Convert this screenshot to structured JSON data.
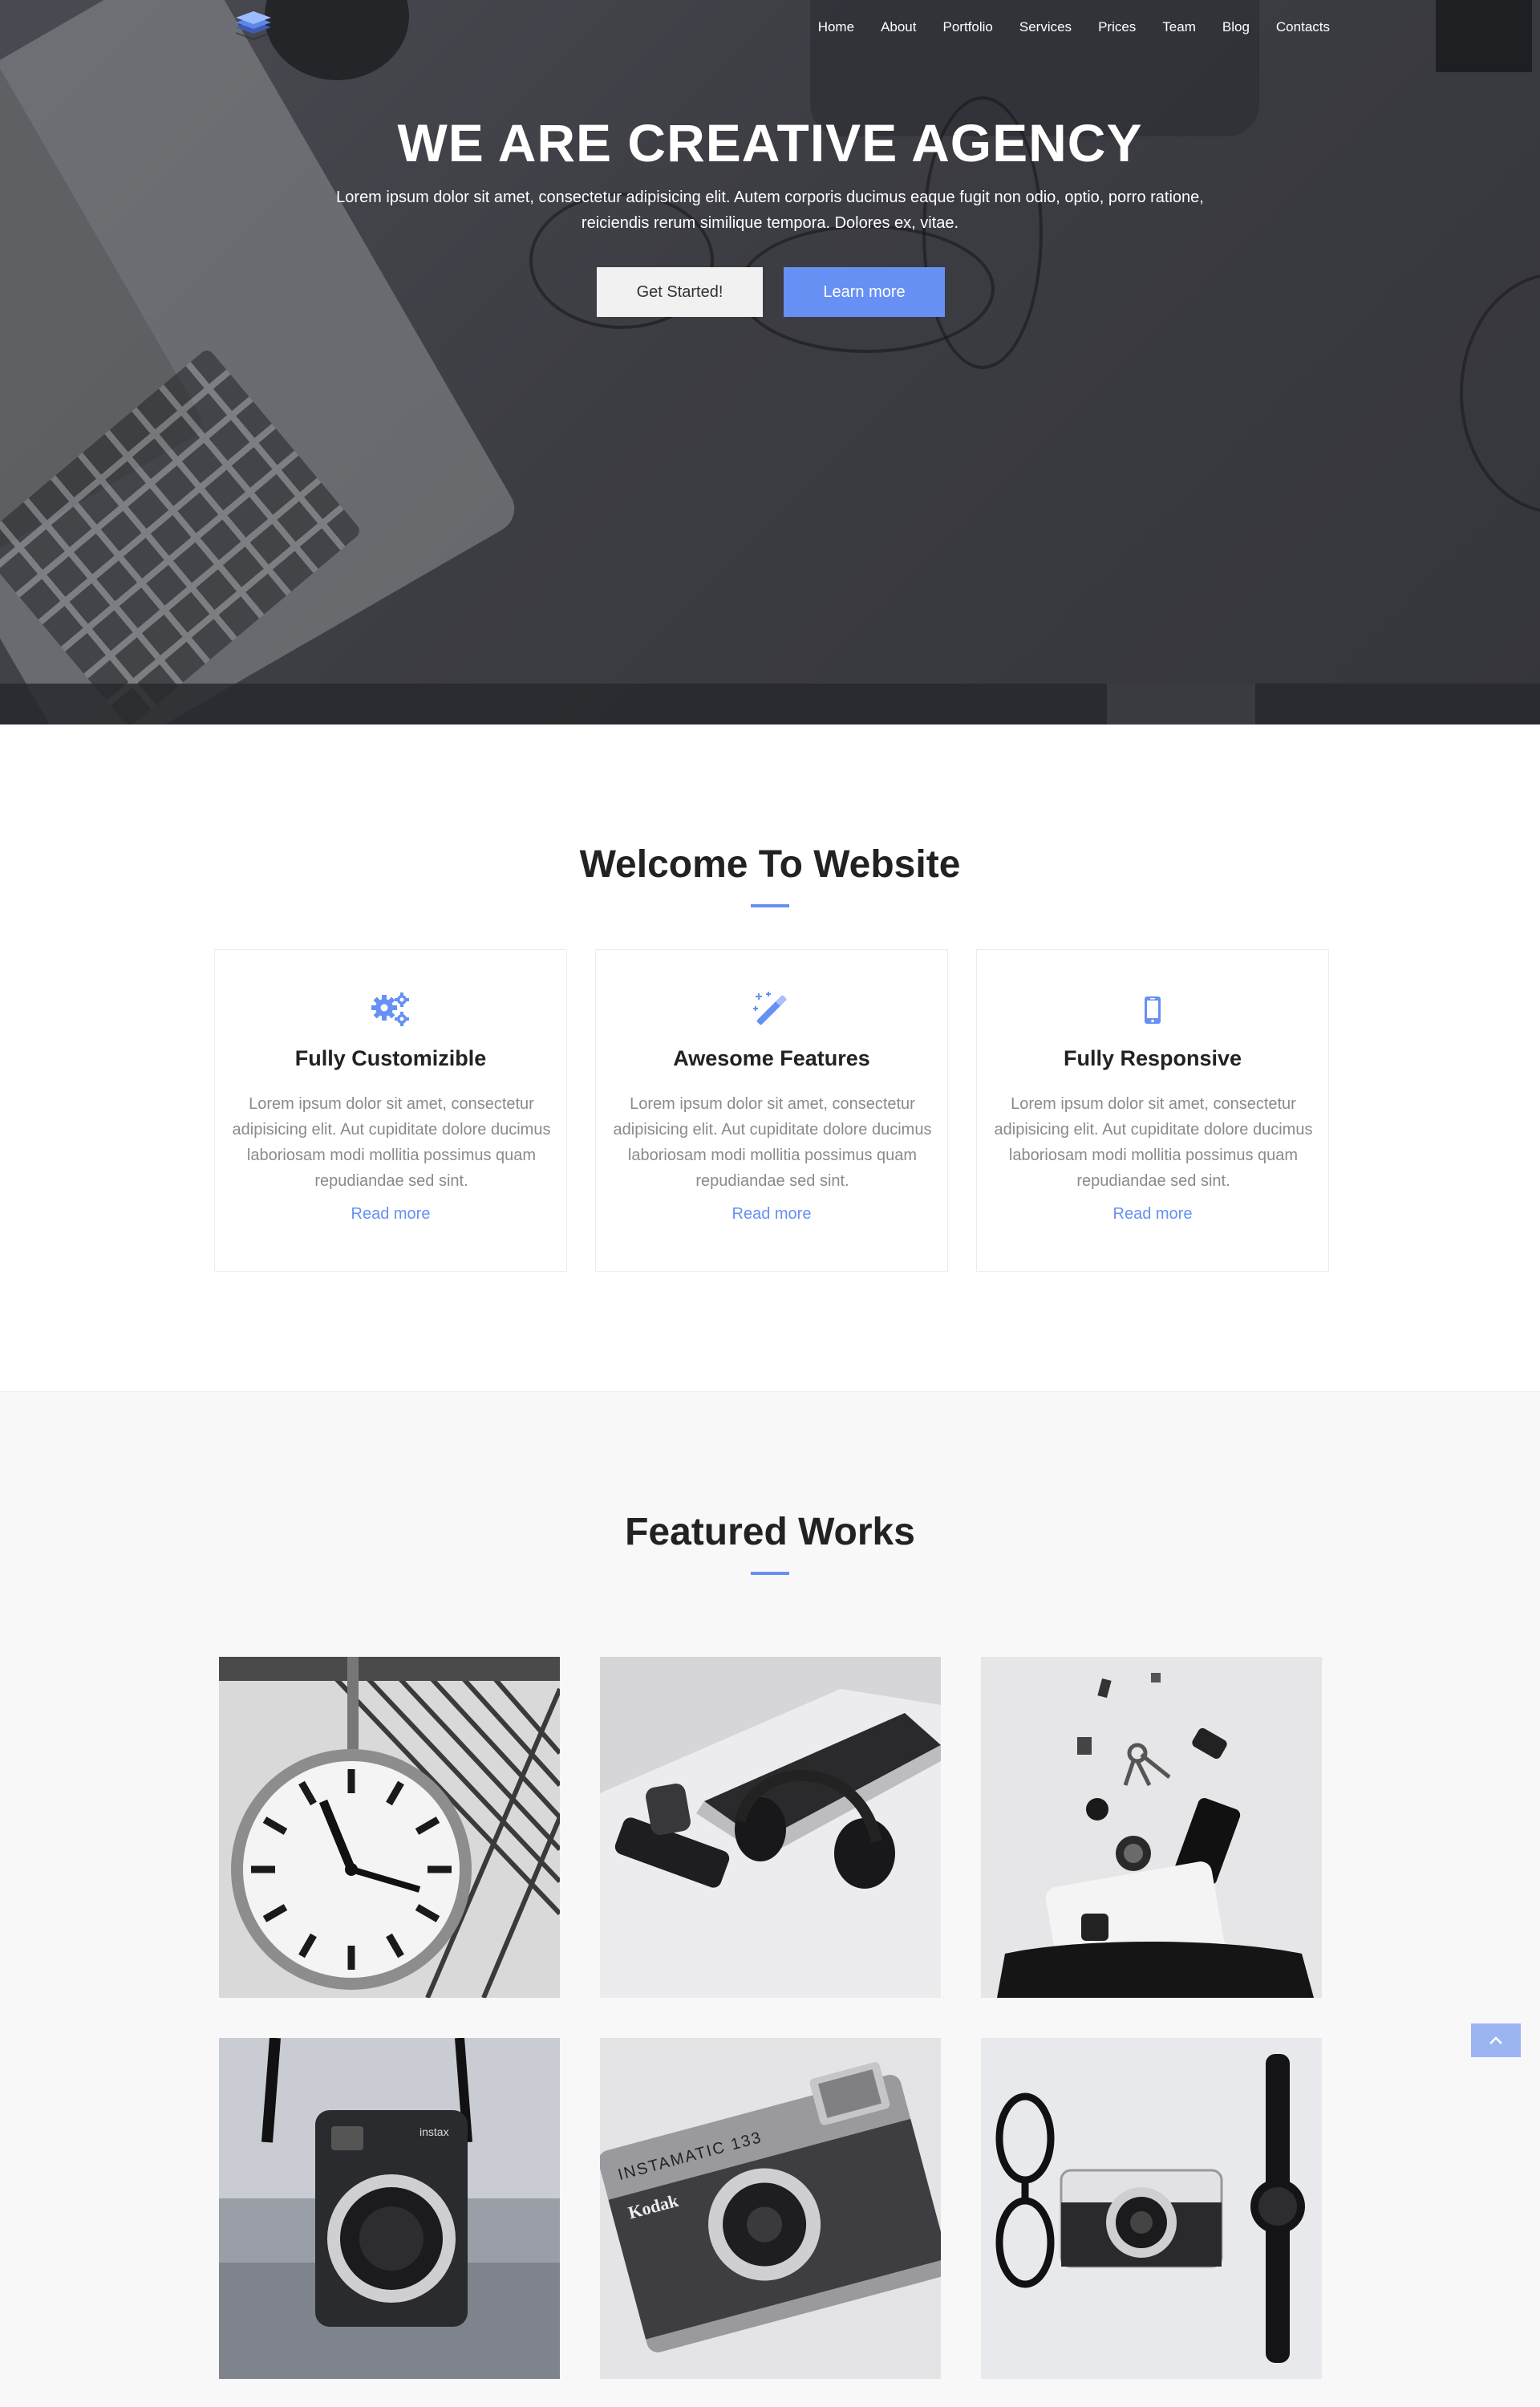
{
  "nav": {
    "items": [
      "Home",
      "About",
      "Portfolio",
      "Services",
      "Prices",
      "Team",
      "Blog",
      "Contacts"
    ]
  },
  "hero": {
    "title": "WE ARE CREATIVE AGENCY",
    "text": "Lorem ipsum dolor sit amet, consectetur adipisicing elit. Autem corporis ducimus eaque fugit non odio, optio, porro ratione, reiciendis rerum similique tempora. Dolores ex, vitae.",
    "btn_start": "Get Started!",
    "btn_learn": "Learn more"
  },
  "welcome": {
    "title": "Welcome To Website",
    "cards": [
      {
        "icon": "gears-icon",
        "title": "Fully Customizible",
        "text": "Lorem ipsum dolor sit amet, consectetur adipisicing elit. Aut cupiditate dolore ducimus laboriosam modi mollitia possimus quam repudiandae sed sint.",
        "link": "Read more"
      },
      {
        "icon": "magic-wand-icon",
        "title": "Awesome Features",
        "text": "Lorem ipsum dolor sit amet, consectetur adipisicing elit. Aut cupiditate dolore ducimus laboriosam modi mollitia possimus quam repudiandae sed sint.",
        "link": "Read more"
      },
      {
        "icon": "mobile-phone-icon",
        "title": "Fully Responsive",
        "text": "Lorem ipsum dolor sit amet, consectetur adipisicing elit. Aut cupiditate dolore ducimus laboriosam modi mollitia possimus quam repudiandae sed sint.",
        "link": "Read more"
      }
    ]
  },
  "featured": {
    "title": "Featured Works",
    "works": [
      {
        "image": "station-clock-photo"
      },
      {
        "image": "headphones-laptop-phone-photo"
      },
      {
        "image": "bag-items-flatlay-photo"
      },
      {
        "image": "instax-camera-photo",
        "brand": "instax"
      },
      {
        "image": "kodak-camera-photo",
        "brand": "Kodak",
        "model": "INSTAMATIC 133"
      },
      {
        "image": "camera-glasses-watch-photo"
      }
    ]
  },
  "colors": {
    "accent": "#6690f4",
    "hero_overlay": "#3c3d43",
    "featured_bg": "#f8f8f9"
  }
}
